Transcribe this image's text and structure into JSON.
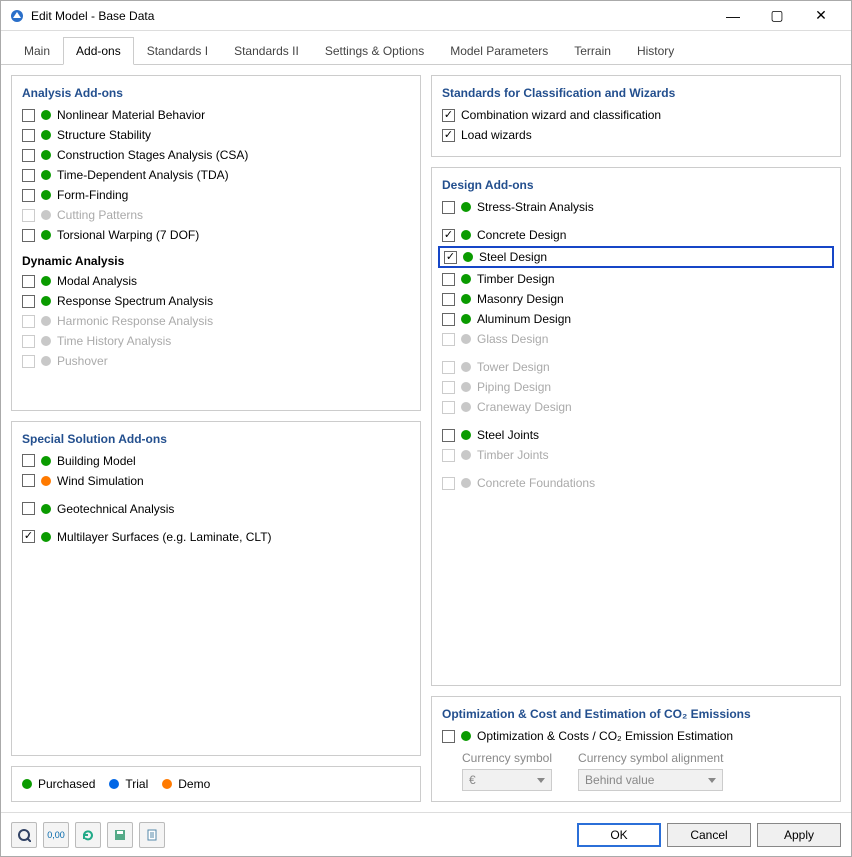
{
  "window": {
    "title": "Edit Model - Base Data"
  },
  "tabs": [
    "Main",
    "Add-ons",
    "Standards I",
    "Standards II",
    "Settings & Options",
    "Model Parameters",
    "Terrain",
    "History"
  ],
  "activeTab": 1,
  "left": {
    "analysis": {
      "title": "Analysis Add-ons",
      "items": [
        {
          "label": "Nonlinear Material Behavior",
          "checked": false,
          "status": "green",
          "enabled": true
        },
        {
          "label": "Structure Stability",
          "checked": false,
          "status": "green",
          "enabled": true
        },
        {
          "label": "Construction Stages Analysis (CSA)",
          "checked": false,
          "status": "green",
          "enabled": true
        },
        {
          "label": "Time-Dependent Analysis (TDA)",
          "checked": false,
          "status": "green",
          "enabled": true
        },
        {
          "label": "Form-Finding",
          "checked": false,
          "status": "green",
          "enabled": true
        },
        {
          "label": "Cutting Patterns",
          "checked": false,
          "status": "grey",
          "enabled": false
        },
        {
          "label": "Torsional Warping (7 DOF)",
          "checked": false,
          "status": "green",
          "enabled": true
        }
      ],
      "dynamicTitle": "Dynamic Analysis",
      "dynamic": [
        {
          "label": "Modal Analysis",
          "checked": false,
          "status": "green",
          "enabled": true
        },
        {
          "label": "Response Spectrum Analysis",
          "checked": false,
          "status": "green",
          "enabled": true
        },
        {
          "label": "Harmonic Response Analysis",
          "checked": false,
          "status": "grey",
          "enabled": false
        },
        {
          "label": "Time History Analysis",
          "checked": false,
          "status": "grey",
          "enabled": false
        },
        {
          "label": "Pushover",
          "checked": false,
          "status": "grey",
          "enabled": false
        }
      ]
    },
    "special": {
      "title": "Special Solution Add-ons",
      "items": [
        {
          "label": "Building Model",
          "checked": false,
          "status": "green",
          "enabled": true
        },
        {
          "label": "Wind Simulation",
          "checked": false,
          "status": "orange",
          "enabled": true
        },
        {
          "label": "Geotechnical Analysis",
          "checked": false,
          "status": "green",
          "enabled": true,
          "spaced": true
        },
        {
          "label": "Multilayer Surfaces (e.g. Laminate, CLT)",
          "checked": true,
          "status": "green",
          "enabled": true,
          "spaced": true
        }
      ]
    }
  },
  "right": {
    "standards": {
      "title": "Standards for Classification and Wizards",
      "items": [
        {
          "label": "Combination wizard and classification",
          "checked": true,
          "enabled": true
        },
        {
          "label": "Load wizards",
          "checked": true,
          "enabled": true
        }
      ]
    },
    "design": {
      "title": "Design Add-ons",
      "items": [
        {
          "label": "Stress-Strain Analysis",
          "checked": false,
          "status": "green",
          "enabled": true
        },
        {
          "label": "Concrete Design",
          "checked": true,
          "status": "green",
          "enabled": true,
          "spaced": true
        },
        {
          "label": "Steel Design",
          "checked": true,
          "status": "green",
          "enabled": true,
          "highlight": true
        },
        {
          "label": "Timber Design",
          "checked": false,
          "status": "green",
          "enabled": true
        },
        {
          "label": "Masonry Design",
          "checked": false,
          "status": "green",
          "enabled": true
        },
        {
          "label": "Aluminum Design",
          "checked": false,
          "status": "green",
          "enabled": true
        },
        {
          "label": "Glass Design",
          "checked": false,
          "status": "grey",
          "enabled": false
        },
        {
          "label": "Tower Design",
          "checked": false,
          "status": "grey",
          "enabled": false,
          "spaced": true
        },
        {
          "label": "Piping Design",
          "checked": false,
          "status": "grey",
          "enabled": false
        },
        {
          "label": "Craneway Design",
          "checked": false,
          "status": "grey",
          "enabled": false
        },
        {
          "label": "Steel Joints",
          "checked": false,
          "status": "green",
          "enabled": true,
          "spaced": true
        },
        {
          "label": "Timber Joints",
          "checked": false,
          "status": "grey",
          "enabled": false
        },
        {
          "label": "Concrete Foundations",
          "checked": false,
          "status": "grey",
          "enabled": false,
          "spaced": true
        }
      ]
    },
    "optimization": {
      "title": "Optimization & Cost and Estimation of CO₂ Emissions",
      "item": {
        "label": "Optimization & Costs / CO₂ Emission Estimation",
        "checked": false,
        "status": "green",
        "enabled": true
      },
      "currencyLabel": "Currency symbol",
      "currencyValue": "€",
      "alignmentLabel": "Currency symbol alignment",
      "alignmentValue": "Behind value"
    }
  },
  "legend": {
    "purchased": "Purchased",
    "trial": "Trial",
    "demo": "Demo"
  },
  "buttons": {
    "ok": "OK",
    "cancel": "Cancel",
    "apply": "Apply"
  }
}
